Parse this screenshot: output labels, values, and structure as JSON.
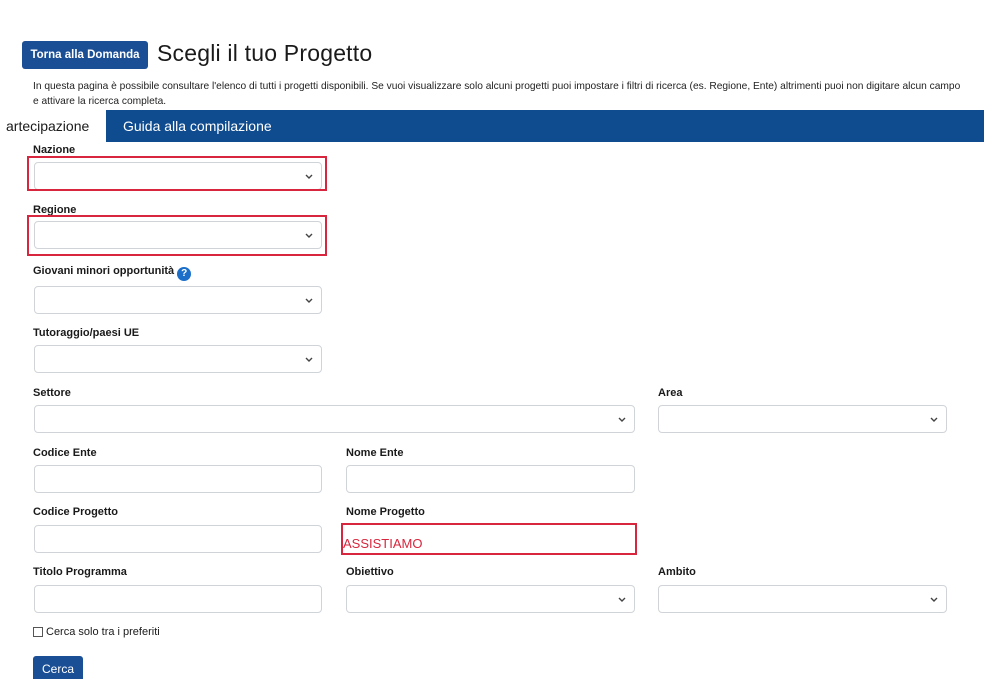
{
  "header": {
    "back_button_label": "Torna alla Domanda",
    "title": "Scegli il tuo Progetto",
    "intro": "In questa pagina è possibile consultare l'elenco di tutti i progetti disponibili. Se vuoi visualizzare solo alcuni progetti puoi impostare i filtri di ricerca (es. Regione, Ente) altrimenti puoi non digitare alcun campo e attivare la ricerca completa."
  },
  "tabs": [
    {
      "label": "artecipazione",
      "active": true
    },
    {
      "label": "Guida alla compilazione",
      "active": false
    }
  ],
  "form": {
    "nazione": {
      "label": "Nazione",
      "value": ""
    },
    "regione": {
      "label": "Regione",
      "value": ""
    },
    "giovani": {
      "label": "Giovani minori opportunità",
      "value": "",
      "help_icon": "question-circle-icon"
    },
    "tutoraggio": {
      "label": "Tutoraggio/paesi UE",
      "value": ""
    },
    "settore": {
      "label": "Settore",
      "value": ""
    },
    "area": {
      "label": "Area",
      "value": ""
    },
    "codice_ente": {
      "label": "Codice Ente",
      "value": ""
    },
    "nome_ente": {
      "label": "Nome Ente",
      "value": ""
    },
    "codice_progetto": {
      "label": "Codice Progetto",
      "value": ""
    },
    "nome_progetto": {
      "label": "Nome Progetto",
      "value": "ASSISTIAMO"
    },
    "titolo_programma": {
      "label": "Titolo Programma",
      "value": ""
    },
    "obiettivo": {
      "label": "Obiettivo",
      "value": ""
    },
    "ambito": {
      "label": "Ambito",
      "value": ""
    },
    "preferiti": {
      "label": "Cerca solo tra i preferiti",
      "checked": false
    },
    "search_button_label": "Cerca"
  },
  "colors": {
    "brand_blue": "#0f4b8f",
    "button_blue": "#1a4f96",
    "highlight_red": "#d7263d"
  }
}
